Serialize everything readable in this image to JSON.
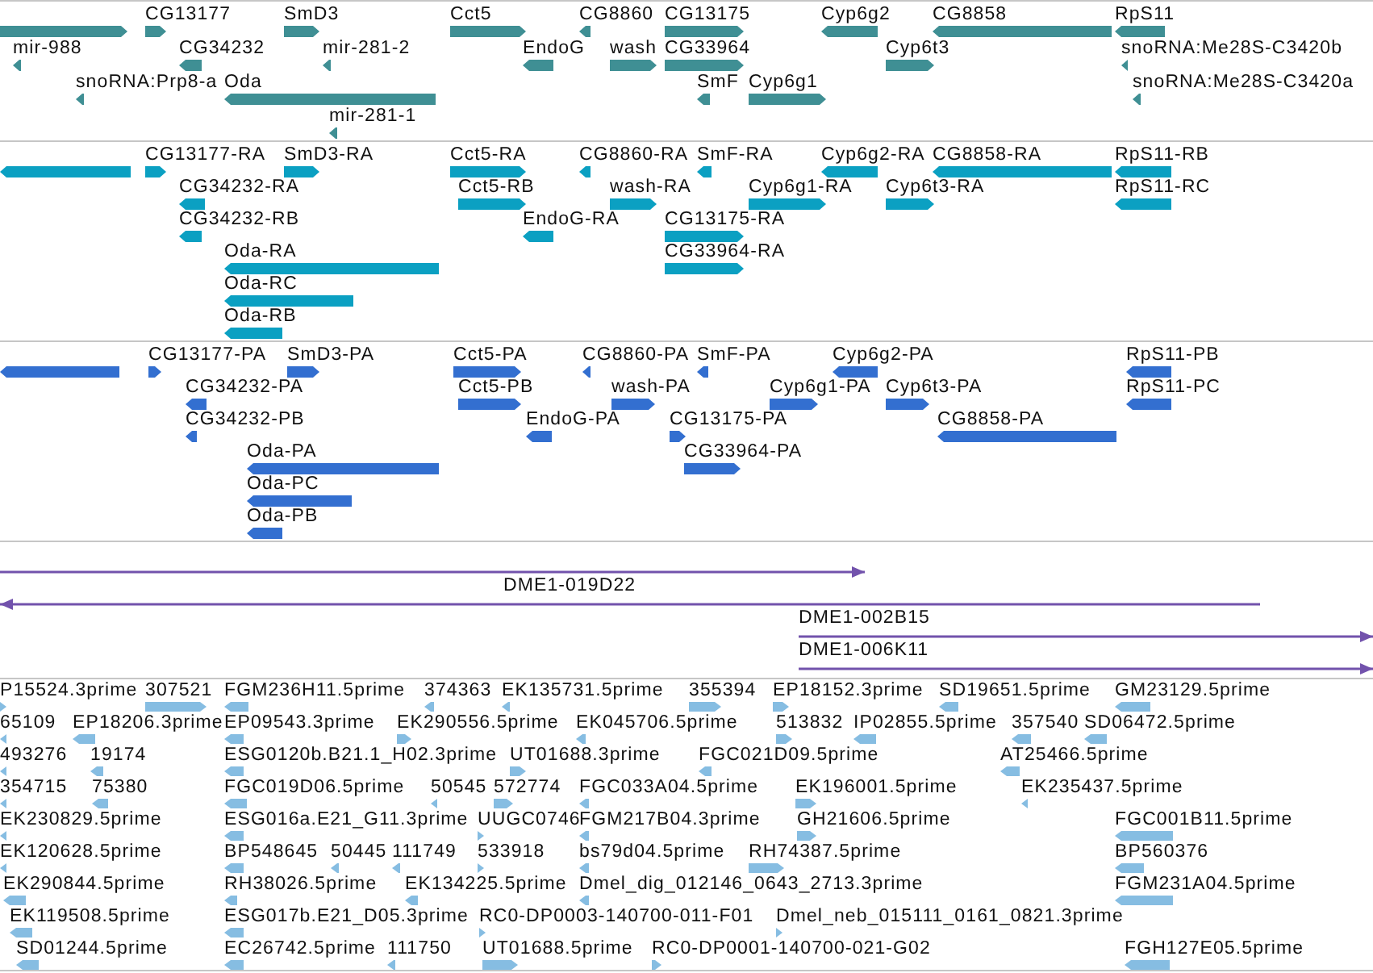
{
  "tracks": [
    {
      "kind": "gene",
      "color": "#3f8f94",
      "features": [
        {
          "reverse": false
        },
        {
          "label": "CG13177",
          "reverse": false
        },
        {
          "label": "SmD3",
          "reverse": false
        },
        {
          "label": "Cct5",
          "reverse": false
        },
        {
          "label": "CG8860",
          "reverse": true
        },
        {
          "label": "CG13175",
          "reverse": false
        },
        {
          "label": "Cyp6g2",
          "reverse": true
        },
        {
          "label": "CG8858",
          "reverse": true
        },
        {
          "label": "RpS11",
          "reverse": true
        },
        {
          "label": "mir-988",
          "reverse": true
        },
        {
          "label": "CG34232",
          "reverse": true
        },
        {
          "label": "mir-281-2",
          "reverse": true
        },
        {
          "label": "EndoG",
          "reverse": true
        },
        {
          "label": "wash",
          "reverse": false
        },
        {
          "label": "CG33964",
          "reverse": false
        },
        {
          "label": "Cyp6t3",
          "reverse": false
        },
        {
          "label": "snoRNA:Me28S-C3420b",
          "reverse": true
        },
        {
          "label": "snoRNA:Prp8-a",
          "reverse": true
        },
        {
          "label": "Oda",
          "reverse": true
        },
        {
          "label": "SmF",
          "reverse": true
        },
        {
          "label": "Cyp6g1",
          "reverse": false
        },
        {
          "label": "snoRNA:Me28S-C3420a",
          "reverse": true
        },
        {
          "label": "mir-281-1",
          "reverse": true
        }
      ]
    },
    {
      "kind": "gene",
      "color": "#0ba0c2",
      "features": [
        {
          "reverse": true
        },
        {
          "label": "CG13177-RA",
          "reverse": false
        },
        {
          "label": "SmD3-RA",
          "reverse": false
        },
        {
          "label": "Cct5-RA",
          "reverse": false
        },
        {
          "label": "CG8860-RA",
          "reverse": true
        },
        {
          "label": "SmF-RA",
          "reverse": true
        },
        {
          "label": "Cyp6g2-RA",
          "reverse": true
        },
        {
          "label": "CG8858-RA",
          "reverse": true
        },
        {
          "label": "RpS11-RB",
          "reverse": true
        },
        {
          "label": "CG34232-RA",
          "reverse": true
        },
        {
          "label": "Cct5-RB",
          "reverse": false
        },
        {
          "label": "wash-RA",
          "reverse": false
        },
        {
          "label": "Cyp6g1-RA",
          "reverse": false
        },
        {
          "label": "Cyp6t3-RA",
          "reverse": false
        },
        {
          "label": "RpS11-RC",
          "reverse": true
        },
        {
          "label": "CG34232-RB",
          "reverse": true
        },
        {
          "label": "EndoG-RA",
          "reverse": true
        },
        {
          "label": "CG13175-RA",
          "reverse": false
        },
        {
          "label": "Oda-RA",
          "reverse": true
        },
        {
          "label": "CG33964-RA",
          "reverse": false
        },
        {
          "label": "Oda-RC",
          "reverse": true
        },
        {
          "label": "Oda-RB",
          "reverse": true
        }
      ]
    },
    {
      "kind": "gene",
      "color": "#336fd0",
      "features": [
        {
          "reverse": true
        },
        {
          "label": "CG13177-PA",
          "reverse": false
        },
        {
          "label": "SmD3-PA",
          "reverse": false
        },
        {
          "label": "Cct5-PA",
          "reverse": false
        },
        {
          "label": "CG8860-PA",
          "reverse": true
        },
        {
          "label": "SmF-PA",
          "reverse": true
        },
        {
          "label": "Cyp6g2-PA",
          "reverse": true
        },
        {
          "label": "RpS11-PB",
          "reverse": true
        },
        {
          "label": "CG34232-PA",
          "reverse": true
        },
        {
          "label": "Cct5-PB",
          "reverse": false
        },
        {
          "label": "wash-PA",
          "reverse": false
        },
        {
          "label": "Cyp6g1-PA",
          "reverse": false
        },
        {
          "label": "Cyp6t3-PA",
          "reverse": false
        },
        {
          "label": "RpS11-PC",
          "reverse": true
        },
        {
          "label": "CG34232-PB",
          "reverse": true
        },
        {
          "label": "EndoG-PA",
          "reverse": true
        },
        {
          "label": "CG13175-PA",
          "reverse": false
        },
        {
          "label": "CG8858-PA",
          "reverse": true
        },
        {
          "label": "Oda-PA",
          "reverse": true
        },
        {
          "label": "CG33964-PA",
          "reverse": false
        },
        {
          "label": "Oda-PC",
          "reverse": true
        },
        {
          "label": "Oda-PB",
          "reverse": true
        }
      ]
    },
    {
      "kind": "clone",
      "color": "#7252ac",
      "features": [
        {
          "reverse": false
        },
        {
          "label": "DME1-019D22",
          "reverse": true
        },
        {
          "label": "DME1-002B15",
          "reverse": false
        },
        {
          "label": "DME1-006K11",
          "reverse": false
        }
      ]
    },
    {
      "kind": "est",
      "color": "#86bde2",
      "features": [
        {
          "label": "P15524.3prime",
          "reverse": false
        },
        {
          "label": "307521",
          "reverse": false
        },
        {
          "label": "FGM236H11.5prime",
          "reverse": true
        },
        {
          "label": "374363",
          "reverse": true
        },
        {
          "label": "EK135731.5prime",
          "reverse": true
        },
        {
          "label": "355394",
          "reverse": false
        },
        {
          "label": "EP18152.3prime",
          "reverse": false
        },
        {
          "label": "SD19651.5prime",
          "reverse": true
        },
        {
          "label": "GM23129.5prime",
          "reverse": true
        },
        {
          "label": "65109",
          "reverse": true
        },
        {
          "label": "EP18206.3prime",
          "reverse": true
        },
        {
          "label": "EP09543.3prime",
          "reverse": true
        },
        {
          "label": "EK290556.5prime",
          "reverse": false
        },
        {
          "label": "EK045706.5prime",
          "reverse": true
        },
        {
          "label": "513832",
          "reverse": false
        },
        {
          "label": "IP02855.5prime",
          "reverse": true
        },
        {
          "label": "357540",
          "reverse": true
        },
        {
          "label": "SD06472.5prime",
          "reverse": true
        },
        {
          "label": "493276",
          "reverse": true
        },
        {
          "label": "19174",
          "reverse": true
        },
        {
          "label": "ESG0120b.B21.1_H02.3prime",
          "reverse": true
        },
        {
          "label": "UT01688.3prime",
          "reverse": false
        },
        {
          "label": "FGC021D09.5prime",
          "reverse": true
        },
        {
          "label": "AT25466.5prime",
          "reverse": true
        },
        {
          "label": "354715",
          "reverse": true
        },
        {
          "label": "75380",
          "reverse": true
        },
        {
          "label": "FGC019D06.5prime",
          "reverse": true
        },
        {
          "label": "50545",
          "reverse": true
        },
        {
          "label": "572774",
          "reverse": false
        },
        {
          "label": "FGC033A04.5prime",
          "reverse": true
        },
        {
          "label": "EK196001.5prime",
          "reverse": false
        },
        {
          "label": "EK235437.5prime",
          "reverse": true
        },
        {
          "label": "EK230829.5prime",
          "reverse": true
        },
        {
          "label": "ESG016a.E21_G11.3prime",
          "reverse": true
        },
        {
          "label": "UUGC0746",
          "reverse": false
        },
        {
          "label": "FGM217B04.3prime",
          "reverse": true
        },
        {
          "label": "GH21606.5prime",
          "reverse": false
        },
        {
          "label": "FGC001B11.5prime",
          "reverse": true
        },
        {
          "label": "EK120628.5prime",
          "reverse": true
        },
        {
          "label": "BP548645",
          "reverse": true
        },
        {
          "label": "50445",
          "reverse": true
        },
        {
          "label": "111749",
          "reverse": true
        },
        {
          "label": "533918",
          "reverse": false
        },
        {
          "label": "bs79d04.5prime",
          "reverse": true
        },
        {
          "label": "RH74387.5prime",
          "reverse": false
        },
        {
          "label": "BP560376",
          "reverse": true
        },
        {
          "label": "EK290844.5prime",
          "reverse": true
        },
        {
          "label": "RH38026.5prime",
          "reverse": true
        },
        {
          "label": "EK134225.5prime",
          "reverse": true
        },
        {
          "label": "Dmel_dig_012146_0643_2713.3prime",
          "reverse": true
        },
        {
          "label": "FGM231A04.5prime",
          "reverse": true
        },
        {
          "label": "EK119508.5prime",
          "reverse": true
        },
        {
          "label": "ESG017b.E21_D05.3prime",
          "reverse": true
        },
        {
          "label": "RC0-DP0003-140700-011-F01",
          "reverse": false
        },
        {
          "label": "Dmel_neb_015111_0161_0821.3prime",
          "reverse": false
        },
        {
          "label": "SD01244.5prime",
          "reverse": true
        },
        {
          "label": "EC26742.5prime",
          "reverse": true
        },
        {
          "label": "111750",
          "reverse": true
        },
        {
          "label": "UT01688.5prime",
          "reverse": false
        },
        {
          "label": "RC0-DP0001-140700-021-G02",
          "reverse": false
        },
        {
          "label": "FGH127E05.5prime",
          "reverse": true
        }
      ]
    }
  ]
}
